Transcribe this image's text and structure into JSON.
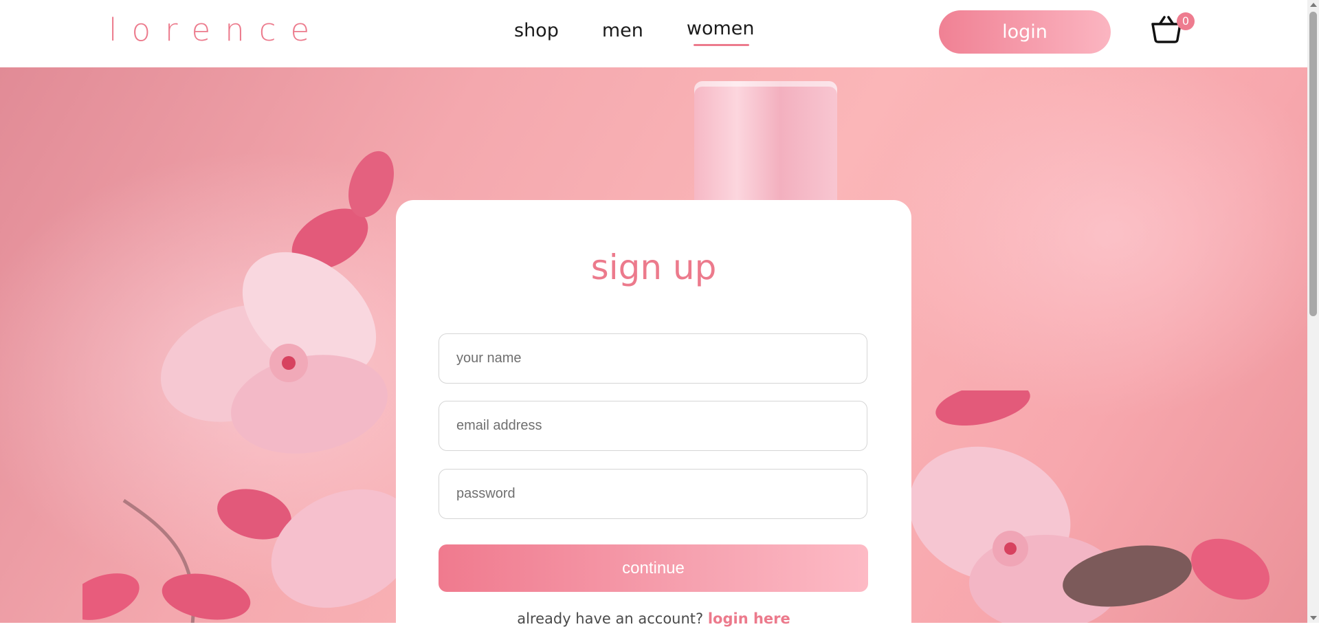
{
  "header": {
    "logo": "lorence",
    "nav": {
      "items": [
        {
          "label": "shop"
        },
        {
          "label": "men"
        },
        {
          "label": "women",
          "active": true
        }
      ]
    },
    "login_label": "login",
    "cart": {
      "icon": "basket-icon",
      "count": "0"
    }
  },
  "signup": {
    "title": "sign up",
    "name_placeholder": "your name",
    "email_placeholder": "email address",
    "password_placeholder": "password",
    "continue_label": "continue",
    "already_text": "already have an account?",
    "login_link": "login here"
  },
  "colors": {
    "accent": "#ec7a8c",
    "button_gradient_start": "#f07a8e",
    "button_gradient_end": "#fdbac5"
  }
}
